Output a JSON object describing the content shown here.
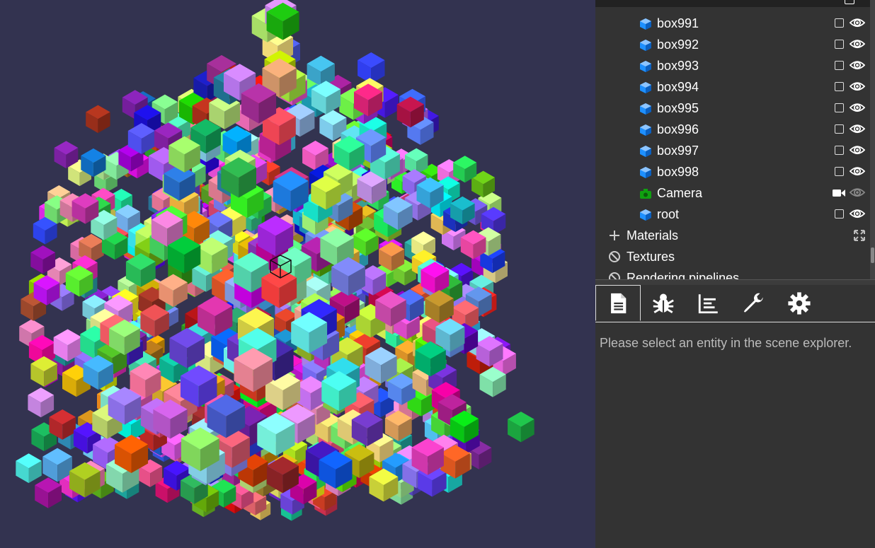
{
  "scene_explorer": {
    "nodes": [
      {
        "label": "box991",
        "type": "mesh"
      },
      {
        "label": "box992",
        "type": "mesh"
      },
      {
        "label": "box993",
        "type": "mesh"
      },
      {
        "label": "box994",
        "type": "mesh"
      },
      {
        "label": "box995",
        "type": "mesh"
      },
      {
        "label": "box996",
        "type": "mesh"
      },
      {
        "label": "box997",
        "type": "mesh"
      },
      {
        "label": "box998",
        "type": "mesh"
      },
      {
        "label": "Camera",
        "type": "camera"
      },
      {
        "label": "root",
        "type": "mesh"
      }
    ],
    "sections": [
      {
        "label": "Materials",
        "icon": "plus-icon"
      },
      {
        "label": "Textures",
        "icon": "ban-icon"
      },
      {
        "label": "Rendering pipelines",
        "icon": "ban-icon"
      }
    ]
  },
  "inspector": {
    "tabs": [
      {
        "name": "properties",
        "icon": "document-icon",
        "active": true
      },
      {
        "name": "debug",
        "icon": "bug-icon",
        "active": false
      },
      {
        "name": "statistics",
        "icon": "chart-icon",
        "active": false
      },
      {
        "name": "tools",
        "icon": "wrench-icon",
        "active": false
      },
      {
        "name": "settings",
        "icon": "gear-icon",
        "active": false
      }
    ],
    "empty_message": "Please select an entity in the scene explorer."
  },
  "colors": {
    "viewport_bg": "#333350",
    "panel_bg": "#333333",
    "mesh_icon": "#1e90ff",
    "camera_icon": "#10a010"
  }
}
